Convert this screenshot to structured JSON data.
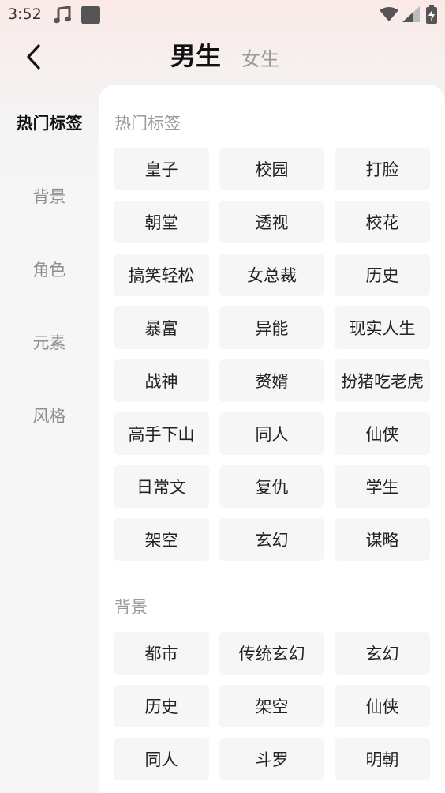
{
  "status_bar": {
    "time": "3:52"
  },
  "header": {
    "tabs": [
      {
        "label": "男生",
        "active": true
      },
      {
        "label": "女生",
        "active": false
      }
    ]
  },
  "sidebar": {
    "items": [
      {
        "label": "热门标签",
        "active": true
      },
      {
        "label": "背景",
        "active": false
      },
      {
        "label": "角色",
        "active": false
      },
      {
        "label": "元素",
        "active": false
      },
      {
        "label": "风格",
        "active": false
      }
    ]
  },
  "sections": [
    {
      "title": "热门标签",
      "tags": [
        "皇子",
        "校园",
        "打脸",
        "朝堂",
        "透视",
        "校花",
        "搞笑轻松",
        "女总裁",
        "历史",
        "暴富",
        "异能",
        "现实人生",
        "战神",
        "赘婿",
        "扮猪吃老虎",
        "高手下山",
        "同人",
        "仙侠",
        "日常文",
        "复仇",
        "学生",
        "架空",
        "玄幻",
        "谋略"
      ]
    },
    {
      "title": "背景",
      "tags": [
        "都市",
        "传统玄幻",
        "玄幻",
        "历史",
        "架空",
        "仙侠",
        "同人",
        "斗罗",
        "明朝"
      ]
    }
  ],
  "colors": {
    "accent": "#111111",
    "muted": "#9a9a9a",
    "tag_bg": "#f6f6f6"
  }
}
